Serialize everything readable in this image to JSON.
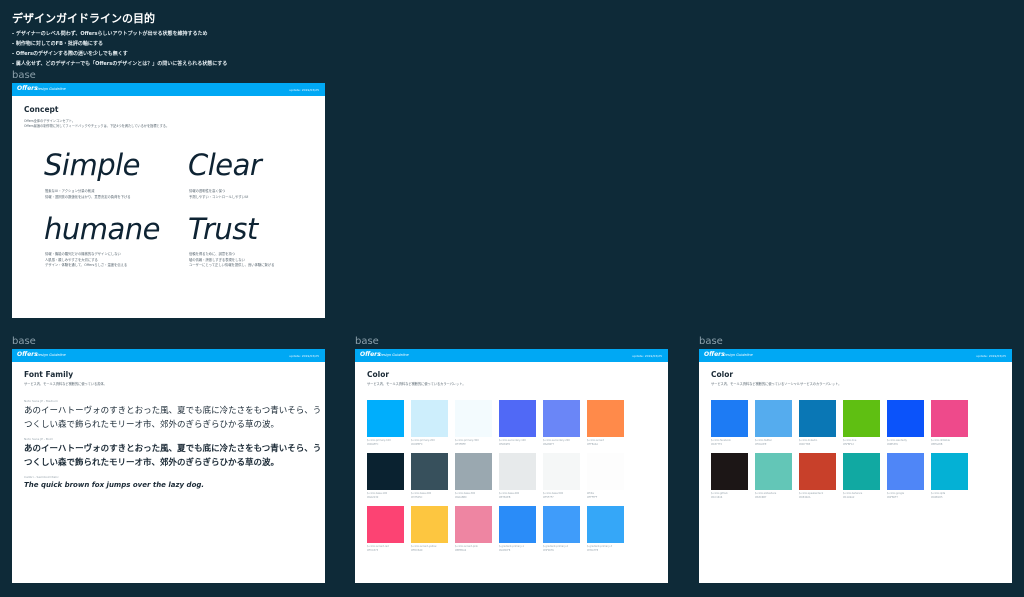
{
  "heading": "デザインガイドラインの目的",
  "bullets": [
    "- デザイナーのレベル問わず、Offersらしいアウトプットが出せる状態を維持するため",
    "- 制作物に対してのFB・批評の軸にする",
    "- Offersのデザインする際の迷いを少しでも無くす",
    "- 属人化せず、どのデザイナーでも「Offersのデザインとは？」の問いに答えられる状態にする"
  ],
  "frame_label": "base",
  "header": {
    "brand": "Offers",
    "sub": "Design Guideline",
    "updated": "update: 2019/03/25"
  },
  "concept": {
    "title": "Concept",
    "desc": [
      "Offers全体のデザインコンセプト。",
      "Offers最適の制作物に対してフィードバックやチェックは、下記4つを満たしているかを指標とする。"
    ],
    "words": [
      {
        "word": "Simple",
        "desc": [
          "簡素なUI・アクション分量の削減",
          "情報・選択肢の数値化をはかり、意思決定の負荷を下げる"
        ]
      },
      {
        "word": "Clear",
        "desc": [
          "情報の透明性を高く保つ",
          "予測しやすい・コントロールしやすいUI"
        ]
      },
      {
        "word": "humane",
        "desc": [
          "情報・機能の羅列だけの機械的なデザインにしない",
          "人肌感・親しみやすさを大切にする",
          "デザイン・体験を通して、Offersらしさ・温度を伝える"
        ]
      },
      {
        "word": "Trust",
        "desc": [
          "信頼を得るために、誠意を持つ",
          "嘘の情報・誇張しすぎる表現をしない",
          "ユーザーにとって正しい情報を提供し、良い体験に繋げる"
        ]
      }
    ]
  },
  "fontfamily": {
    "title": "Font Family",
    "desc": "サービス内、モールス資料など横断的に使っている書体。",
    "samples": [
      {
        "label": "Noto Sans JP - Medium",
        "text": "あのイーハトーヴォのすきとおった風、夏でも底に冷たさをもつ青いそら、うつくしい森で飾られたモリーオ市、郊外のぎらぎらひかる草の波。"
      },
      {
        "label": "Noto Sans JP - Bold",
        "text": "あのイーハトーヴォのすきとおった風、夏でも底に冷たさをもつ青いそら、うつくしい森で飾られたモリーオ市、郊外のぎらぎらひかる草の波。"
      }
    ],
    "eng_label": "Calibri - Semibold Italic",
    "eng_text": "The quick brown fox jumps over the lazy dog."
  },
  "color1": {
    "title": "Color",
    "desc": "サービス内、モールス資料など横断的に使っているカラーパレット。",
    "swatches": [
      {
        "color": "#00aefc",
        "name": "$-color-primary-100",
        "hex": "#00AEFC"
      },
      {
        "color": "#cdeefc",
        "name": "$-color-primary-200",
        "hex": "#CDEEFC"
      },
      {
        "color": "#f3fbfe",
        "name": "$-color-primary-300",
        "hex": "#F3FBFE"
      },
      {
        "color": "#5069f6",
        "name": "$-color-secondary-100",
        "hex": "#5069F6"
      },
      {
        "color": "#6a86f7",
        "name": "$-color-secondary-200",
        "hex": "#6A86F7"
      },
      {
        "color": "#ff8a4a",
        "name": "$-color-accent",
        "hex": "#FF8A4A"
      },
      {
        "color": "#0a2230",
        "name": "$-color-base-100",
        "hex": "#0A2230"
      },
      {
        "color": "#37505c",
        "name": "$-color-base-200",
        "hex": "#37505C"
      },
      {
        "color": "#9aa8b0",
        "name": "$-color-base-300",
        "hex": "#9AA8B0"
      },
      {
        "color": "#e7eaeb",
        "name": "$-color-base-400",
        "hex": "#E7EAEB"
      },
      {
        "color": "#f5f7f7",
        "name": "$-color-base-500",
        "hex": "#F5F7F7"
      },
      {
        "color": "#fdfdfd",
        "name": "White",
        "hex": "#FFFFFF"
      },
      {
        "color": "#fc4373",
        "name": "$-color-accent-red",
        "hex": "#FC4373"
      },
      {
        "color": "#fdc640",
        "name": "$-color-accent-yellow",
        "hex": "#FDC640"
      },
      {
        "color": "#ee85a2",
        "name": "$-color-accent-pink",
        "hex": "#EE85A2"
      },
      {
        "color": "#2a8cf8",
        "name": "$-gradient-primary-1",
        "hex": "#2A8CF8"
      },
      {
        "color": "#3f9cfa",
        "name": "$-gradient-primary-2",
        "hex": "#3F9CFA"
      },
      {
        "color": "#35a7f8",
        "name": "$-gradient-primary-3",
        "hex": "#35A7F8"
      }
    ]
  },
  "color2": {
    "title": "Color",
    "desc": "サービス内、モールス資料など横断的に使っているソーシャルサービスのカラーパレット。",
    "swatches": [
      {
        "color": "#1d7bf4",
        "name": "$-color-facebook",
        "hex": "#1877F2"
      },
      {
        "color": "#55acee",
        "name": "$-color-twitter",
        "hex": "#55ACEE"
      },
      {
        "color": "#0a77b5",
        "name": "$-color-linkedin",
        "hex": "#0077B5"
      },
      {
        "color": "#5fbf12",
        "name": "$-color-line",
        "hex": "#5FBF12"
      },
      {
        "color": "#0b53fa",
        "name": "$-color-wantedly",
        "hex": "#0B53FA"
      },
      {
        "color": "#ee4a8b",
        "name": "$-color-dribbble",
        "hex": "#EE4A8B"
      },
      {
        "color": "#1c1616",
        "name": "$-color-github",
        "hex": "#1C1616"
      },
      {
        "color": "#63c6b7",
        "name": "$-color-slideshare",
        "hex": "#63C6B7"
      },
      {
        "color": "#c8402a",
        "name": "$-color-speakerdeck",
        "hex": "#C8402A"
      },
      {
        "color": "#11a9a2",
        "name": "$-color-behance",
        "hex": "#11A9A2"
      },
      {
        "color": "#4f86f7",
        "name": "$-color-google",
        "hex": "#4F86F7"
      },
      {
        "color": "#04b1d5",
        "name": "$-color-qiita",
        "hex": "#04B1D5"
      }
    ]
  }
}
